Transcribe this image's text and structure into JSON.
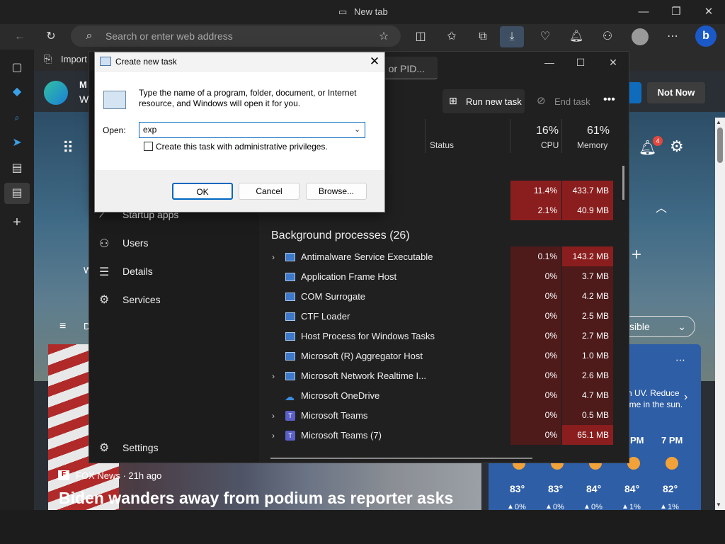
{
  "browser": {
    "tab_title": "New tab",
    "address_placeholder": "Search or enter web address",
    "import_label": "Import",
    "not_now_label": "Not Now",
    "notification_count": "4",
    "visible_pill_label": "sible",
    "page_letter_m": "M",
    "page_letter_w": "W",
    "page_letter_w2": "W",
    "page_letter_d": "D"
  },
  "news": {
    "source": "FOX News · 21h ago",
    "headline": "Biden wanders away from podium as reporter asks"
  },
  "weather": {
    "tip_line1": "h UV. Reduce",
    "tip_line2": "ime in the sun.",
    "hours": [
      "PM",
      "7 PM"
    ],
    "temps": [
      "83°",
      "83°",
      "84°",
      "84°",
      "82°"
    ],
    "precip": [
      "0%",
      "0%",
      "0%",
      "1%",
      "1%"
    ]
  },
  "task_manager": {
    "search_placeholder": "r, or PID...",
    "run_new_task_label": "Run new task",
    "end_task_label": "End task",
    "columns": {
      "status": "Status",
      "cpu_pct": "16%",
      "cpu": "CPU",
      "mem_pct": "61%",
      "memory": "Memory"
    },
    "nav": [
      {
        "label": "Startup apps",
        "icon": "startup-icon"
      },
      {
        "label": "Users",
        "icon": "users-icon"
      },
      {
        "label": "Details",
        "icon": "details-icon"
      },
      {
        "label": "Services",
        "icon": "services-icon"
      },
      {
        "label": "Settings",
        "icon": "settings-icon"
      }
    ],
    "app_rows": [
      {
        "cpu": "11.4%",
        "mem": "433.7 MB"
      },
      {
        "cpu": "2.1%",
        "mem": "40.9 MB"
      }
    ],
    "background_header": "Background processes (26)",
    "processes": [
      {
        "name": "Antimalware Service Executable",
        "cpu": "0.1%",
        "mem": "143.2 MB",
        "expand": true
      },
      {
        "name": "Application Frame Host",
        "cpu": "0%",
        "mem": "3.7 MB",
        "expand": false
      },
      {
        "name": "COM Surrogate",
        "cpu": "0%",
        "mem": "4.2 MB",
        "expand": false
      },
      {
        "name": "CTF Loader",
        "cpu": "0%",
        "mem": "2.5 MB",
        "expand": false
      },
      {
        "name": "Host Process for Windows Tasks",
        "cpu": "0%",
        "mem": "2.7 MB",
        "expand": false
      },
      {
        "name": "Microsoft (R) Aggregator Host",
        "cpu": "0%",
        "mem": "1.0 MB",
        "expand": false
      },
      {
        "name": "Microsoft Network Realtime I...",
        "cpu": "0%",
        "mem": "2.6 MB",
        "expand": true
      },
      {
        "name": "Microsoft OneDrive",
        "cpu": "0%",
        "mem": "4.7 MB",
        "expand": false
      },
      {
        "name": "Microsoft Teams",
        "cpu": "0%",
        "mem": "0.5 MB",
        "expand": true
      },
      {
        "name": "Microsoft Teams (7)",
        "cpu": "0%",
        "mem": "65.1 MB",
        "expand": true
      }
    ]
  },
  "run_dialog": {
    "title": "Create new task",
    "description": "Type the name of a program, folder, document, or Internet resource, and Windows will open it for you.",
    "open_label": "Open:",
    "input_value": "exp",
    "admin_checkbox_label": "Create this task with administrative privileges.",
    "ok_label": "OK",
    "cancel_label": "Cancel",
    "browse_label": "Browse..."
  }
}
